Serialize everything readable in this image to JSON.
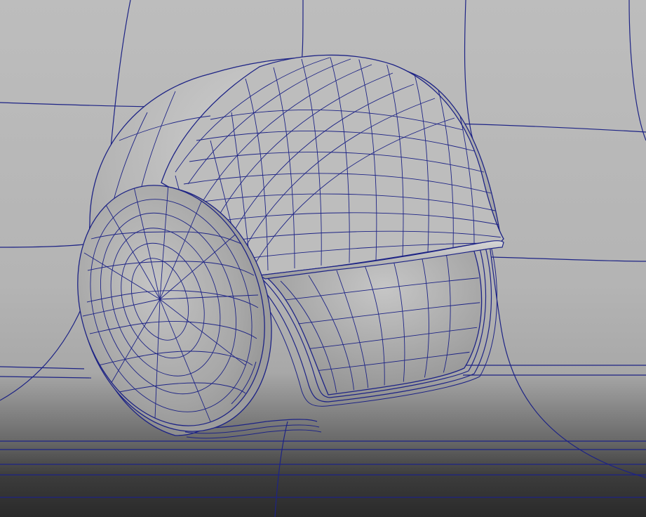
{
  "viewport": {
    "panel": "3d-viewport",
    "shading": "smooth-shade-with-wireframe",
    "wire_color": "#1a1f8a",
    "background_top": "#b9b9b9",
    "background_bottom": "#2f2f2f"
  },
  "objects": [
    {
      "name": "helmet-shell",
      "icon": "polygon-mesh"
    },
    {
      "name": "helmet-ear-cup",
      "icon": "polygon-mesh"
    },
    {
      "name": "helmet-liner",
      "icon": "polygon-mesh"
    },
    {
      "name": "backdrop-cyclorama",
      "icon": "nurbs-plane"
    }
  ]
}
